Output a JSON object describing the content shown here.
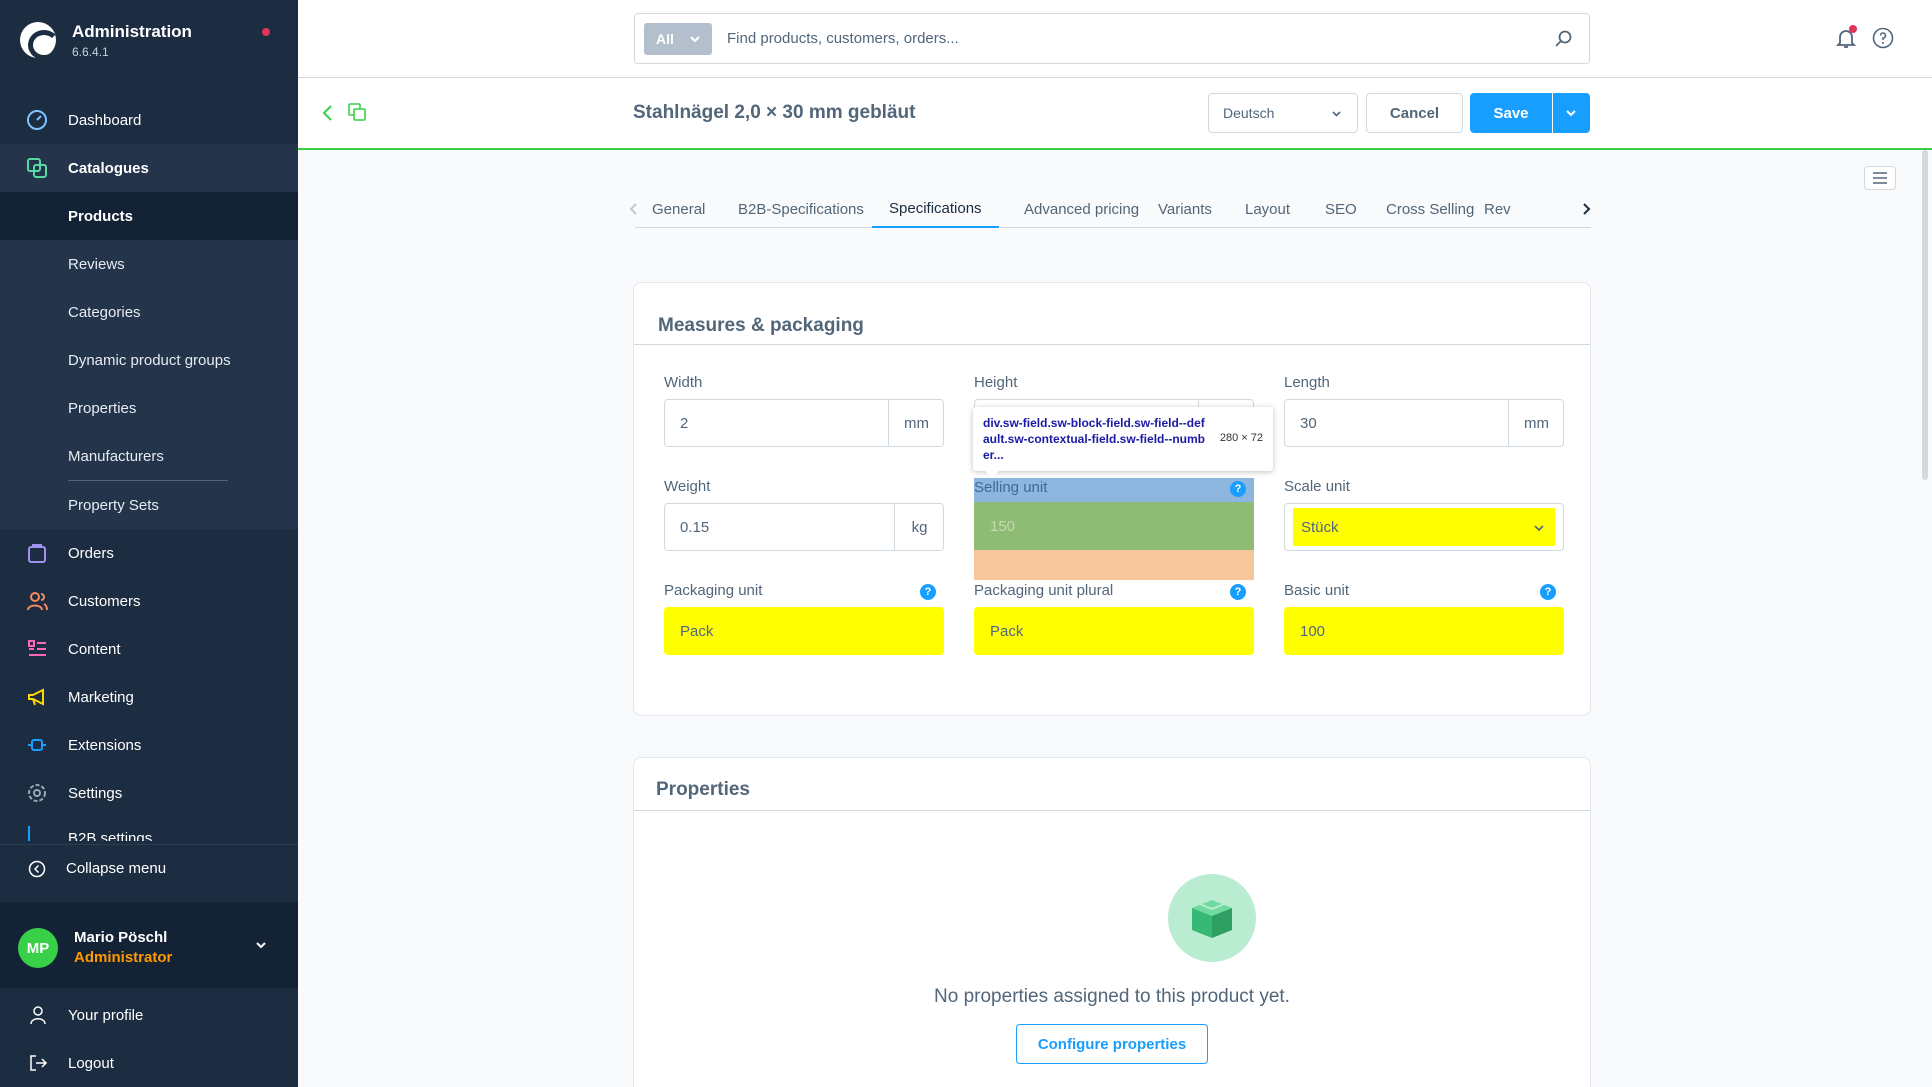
{
  "app": {
    "title": "Administration",
    "version": "6.6.4.1"
  },
  "sidebar": {
    "items": [
      {
        "label": "Dashboard",
        "icon": "dashboard-icon"
      },
      {
        "label": "Catalogues",
        "icon": "catalogue-icon"
      },
      {
        "label": "Orders",
        "icon": "orders-icon"
      },
      {
        "label": "Customers",
        "icon": "customers-icon"
      },
      {
        "label": "Content",
        "icon": "content-icon"
      },
      {
        "label": "Marketing",
        "icon": "marketing-icon"
      },
      {
        "label": "Extensions",
        "icon": "extensions-icon"
      },
      {
        "label": "Settings",
        "icon": "settings-icon"
      },
      {
        "label": "B2B settings",
        "icon": "b2b-icon"
      }
    ],
    "catalogue_sub": [
      "Products",
      "Reviews",
      "Categories",
      "Dynamic product groups",
      "Properties",
      "Manufacturers",
      "Property Sets"
    ],
    "collapse_label": "Collapse menu",
    "user": {
      "initials": "MP",
      "name": "Mario Pöschl",
      "role": "Administrator"
    },
    "profile_label": "Your profile",
    "logout_label": "Logout"
  },
  "header": {
    "search_type": "All",
    "search_placeholder": "Find products, customers, orders..."
  },
  "smartbar": {
    "title": "Stahlnägel 2,0 × 30 mm gebläut",
    "language": "Deutsch",
    "cancel_label": "Cancel",
    "save_label": "Save"
  },
  "tabs": [
    "General",
    "B2B-Specifications",
    "Specifications",
    "Advanced pricing",
    "Variants",
    "Layout",
    "SEO",
    "Cross Selling",
    "Rev"
  ],
  "measures": {
    "title": "Measures & packaging",
    "width": {
      "label": "Width",
      "value": "2",
      "unit": "mm"
    },
    "height": {
      "label": "Height"
    },
    "length": {
      "label": "Length",
      "value": "30",
      "unit": "mm"
    },
    "weight": {
      "label": "Weight",
      "value": "0.15",
      "unit": "kg"
    },
    "selling_unit": {
      "label": "Selling unit",
      "value": "150"
    },
    "scale_unit": {
      "label": "Scale unit",
      "value": "Stück"
    },
    "packaging_unit": {
      "label": "Packaging unit",
      "value": "Pack"
    },
    "packaging_unit_plural": {
      "label": "Packaging unit plural",
      "value": "Pack"
    },
    "basic_unit": {
      "label": "Basic unit",
      "value": "100"
    }
  },
  "properties": {
    "title": "Properties",
    "empty_text": "No properties assigned to this product yet.",
    "configure_label": "Configure properties"
  },
  "inspector_tooltip": {
    "selector": "div.sw-field.sw-block-field.sw-field--default.sw-contextual-field.sw-field--number...",
    "size": "280 × 72"
  },
  "colors": {
    "sidebar_bg": "#1c2c41",
    "accent": "#189eff",
    "success": "#37d046",
    "highlight_yellow": "#ffff00",
    "devtools_margin": "#f6c79b",
    "devtools_padding": "#8fbc74",
    "devtools_content": "#8db6df"
  }
}
